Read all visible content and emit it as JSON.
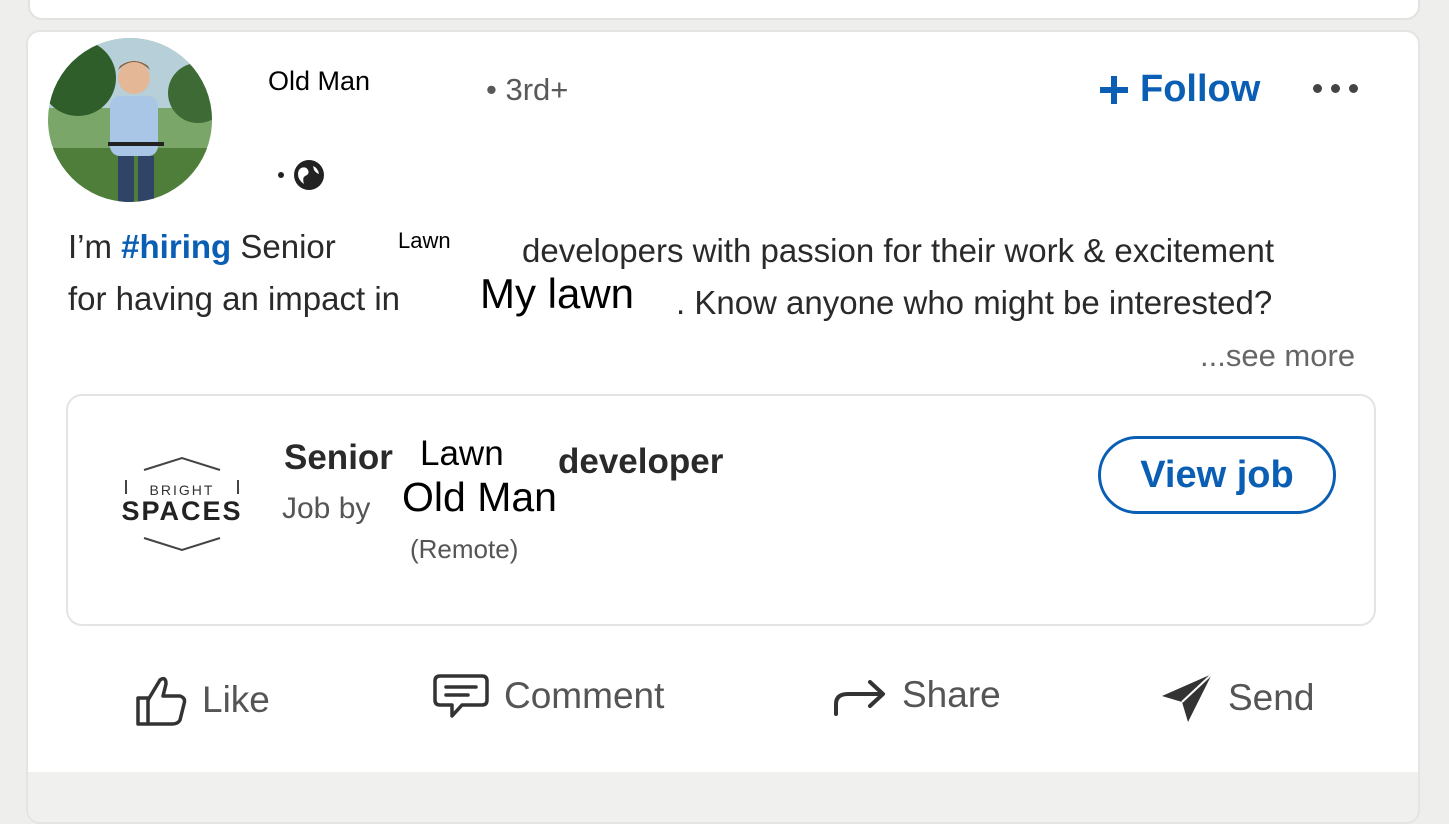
{
  "post": {
    "author_name": "Old Man",
    "connection_degree": "• 3rd+",
    "follow_label": "Follow",
    "text": {
      "line1_prefix": "I’m ",
      "hashtag": "#hiring",
      "line1_mid": " Senior",
      "line1_inserted": "Lawn",
      "line1_suffix": "developers with passion for their work & excitement",
      "line2_prefix": "for having an impact in",
      "line2_inserted": "My lawn",
      "line2_suffix": ". Know anyone who might be interested?"
    },
    "see_more": "...see more"
  },
  "job": {
    "company_logo_text_top": "BRIGHT",
    "company_logo_text_bottom": "SPACES",
    "title_part1": "Senior",
    "title_part2": "Lawn",
    "title_part3": "developer",
    "job_by": "Job by",
    "company": "Old Man",
    "location": "(Remote)",
    "view_job_label": "View job"
  },
  "actions": {
    "like": "Like",
    "comment": "Comment",
    "share": "Share",
    "send": "Send"
  },
  "colors": {
    "accent": "#0a5fb4",
    "text": "#2a2a2a",
    "muted": "#595959",
    "background": "#eeeeec"
  }
}
